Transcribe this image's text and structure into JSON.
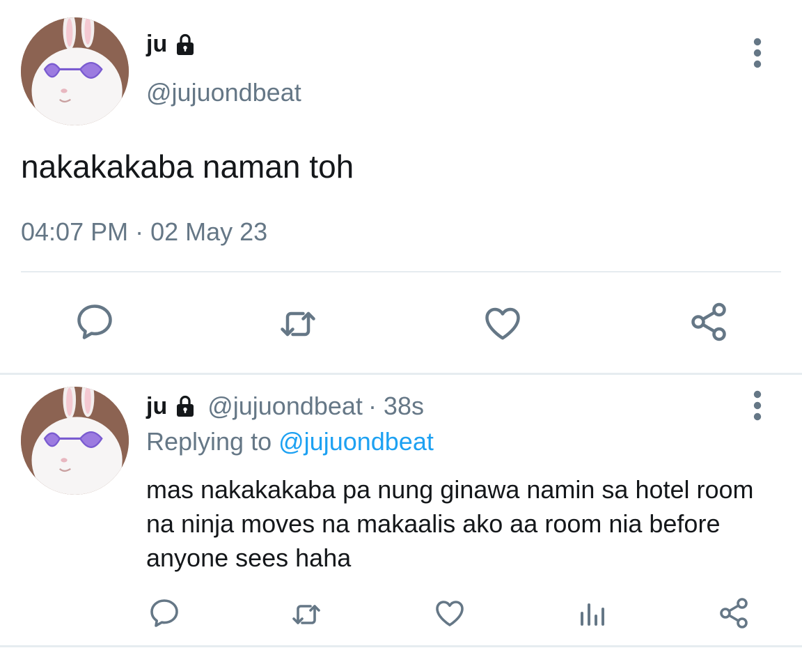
{
  "main_tweet": {
    "display_name": "ju",
    "handle": "@jujuondbeat",
    "text": "nakakakaba naman toh",
    "timestamp": "04:07 PM · 02 May 23",
    "actions": [
      "reply-icon",
      "retweet-icon",
      "like-icon",
      "share-icon"
    ]
  },
  "reply_tweet": {
    "display_name": "ju",
    "handle": "@jujuondbeat",
    "age": "· 38s",
    "replying_prefix": "Replying to",
    "replying_handle": "@jujuondbeat",
    "text": "mas nakakakaba pa nung ginawa namin sa hotel room na ninja moves na makaalis ako aa room nia before anyone sees haha",
    "actions": [
      "reply-icon",
      "retweet-icon",
      "like-icon",
      "analytics-icon",
      "share-icon"
    ]
  },
  "colors": {
    "text": "#14171a",
    "secondary": "#657786",
    "link": "#1da1f2",
    "divider": "#e6ecf0"
  }
}
